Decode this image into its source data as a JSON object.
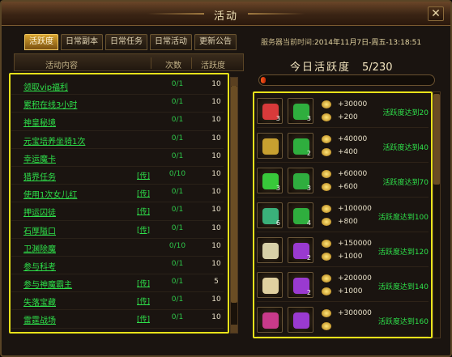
{
  "window": {
    "title": "活动",
    "close_label": "✕"
  },
  "tabs": [
    {
      "label": "活跃度",
      "active": true
    },
    {
      "label": "日常副本",
      "active": false
    },
    {
      "label": "日常任务",
      "active": false
    },
    {
      "label": "日常活动",
      "active": false
    },
    {
      "label": "更新公告",
      "active": false
    }
  ],
  "server_time": {
    "label": "服务器当前时间:",
    "value": "2014年11月7日-周五-13:18:51"
  },
  "list": {
    "headers": {
      "name": "活动内容",
      "count": "次数",
      "activity": "活跃度"
    },
    "rows": [
      {
        "name": "领取vip福利",
        "tag": "",
        "count": "0/1",
        "activity": "10"
      },
      {
        "name": "累积在线3小时",
        "tag": "",
        "count": "0/1",
        "activity": "10"
      },
      {
        "name": "神皇秘境",
        "tag": "",
        "count": "0/1",
        "activity": "10"
      },
      {
        "name": "元宝培养坐骑1次",
        "tag": "",
        "count": "0/1",
        "activity": "10"
      },
      {
        "name": "幸运魔卡",
        "tag": "",
        "count": "0/1",
        "activity": "10"
      },
      {
        "name": "猎界任务",
        "tag": "[传]",
        "count": "0/10",
        "activity": "10"
      },
      {
        "name": "使用1次女儿红",
        "tag": "[传]",
        "count": "0/1",
        "activity": "10"
      },
      {
        "name": "押运囚徒",
        "tag": "[传]",
        "count": "0/1",
        "activity": "10"
      },
      {
        "name": "石厚隘口",
        "tag": "[传]",
        "count": "0/1",
        "activity": "10"
      },
      {
        "name": "卫渊除魔",
        "tag": "",
        "count": "0/10",
        "activity": "10"
      },
      {
        "name": "参与科考",
        "tag": "",
        "count": "0/1",
        "activity": "10"
      },
      {
        "name": "参与神魔霸主",
        "tag": "[传]",
        "count": "0/1",
        "activity": "5"
      },
      {
        "name": "失落宝藏",
        "tag": "[传]",
        "count": "0/1",
        "activity": "10"
      },
      {
        "name": "雷霆战场",
        "tag": "[传]",
        "count": "0/1",
        "activity": "10"
      }
    ]
  },
  "summary": {
    "title": "今日活跃度",
    "count": "5/230",
    "progress_fraction": 0.022
  },
  "rewards": [
    {
      "qty_a": "3",
      "qty_b": "3",
      "gold": "+30000",
      "ingot": "+200",
      "reach": "活跃度达到20",
      "color_a": "#d83a3a",
      "color_b": "#2fae3e"
    },
    {
      "qty_a": "",
      "qty_b": "2",
      "gold": "+40000",
      "ingot": "+400",
      "reach": "活跃度达到40",
      "color_a": "#c8a030",
      "color_b": "#2fae3e"
    },
    {
      "qty_a": "3",
      "qty_b": "3",
      "gold": "+60000",
      "ingot": "+600",
      "reach": "活跃度达到70",
      "color_a": "#38c83a",
      "color_b": "#2fae3e"
    },
    {
      "qty_a": "6",
      "qty_b": "4",
      "gold": "+100000",
      "ingot": "+800",
      "reach": "活跃度达到100",
      "color_a": "#3ab07a",
      "color_b": "#2fae3e"
    },
    {
      "qty_a": "",
      "qty_b": "2",
      "gold": "+150000",
      "ingot": "+1000",
      "reach": "活跃度达到120",
      "color_a": "#d8d0a8",
      "color_b": "#9a3ad0"
    },
    {
      "qty_a": "",
      "qty_b": "2",
      "gold": "+200000",
      "ingot": "+1000",
      "reach": "活跃度达到140",
      "color_a": "#e0d0a0",
      "color_b": "#9a3ad0"
    },
    {
      "qty_a": "",
      "qty_b": "",
      "gold": "+300000",
      "ingot": "",
      "reach": "活跃度达到160",
      "color_a": "#c83a8a",
      "color_b": "#9a3ad0"
    }
  ]
}
